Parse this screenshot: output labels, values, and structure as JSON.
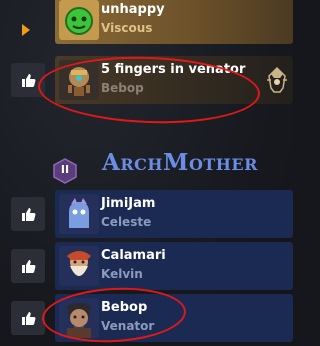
{
  "colors": {
    "row_blue": "#1b2a52",
    "row_gold": "#7a5a2e",
    "sub_text": "#8c9bbb",
    "accent_orange": "#f19a17",
    "title_blue": "#6b8de6",
    "annotation_red": "#e21818"
  },
  "rows": [
    {
      "name": "unhappy",
      "subtitle": "Viscous",
      "highlight": true,
      "liked_button": false,
      "expand_arrow": true,
      "avatar_icon": "slime-avatar-icon"
    },
    {
      "name": "5 fingers in venator",
      "subtitle": "Bebop",
      "highlight": false,
      "liked_button": true,
      "trail_icon": "pharaoh-skull-icon",
      "avatar_icon": "robot-avatar-icon"
    },
    {
      "name": "JimiJam",
      "subtitle": "Celeste",
      "liked_button": true,
      "avatar_icon": "ghost-avatar-icon"
    },
    {
      "name": "Calamari",
      "subtitle": "Kelvin",
      "liked_button": true,
      "avatar_icon": "bearded-avatar-icon"
    },
    {
      "name": "Bebop",
      "subtitle": "Venator",
      "liked_button": true,
      "avatar_icon": "warrior-avatar-icon"
    }
  ],
  "rank": {
    "numeral": "II",
    "title": "ArchMother"
  }
}
